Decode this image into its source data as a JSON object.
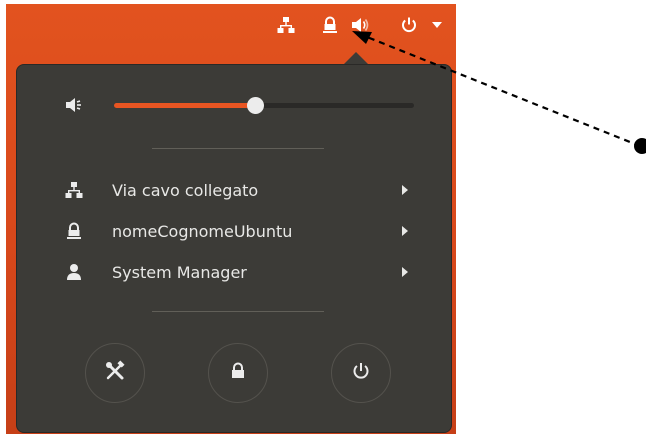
{
  "topbar": {
    "icons": [
      "network-wired-icon",
      "vpn-lock-icon",
      "volume-icon",
      "power-icon",
      "dropdown-arrow-icon"
    ]
  },
  "volume": {
    "level": 0.47,
    "icon": "volume-icon"
  },
  "menu_items": [
    {
      "icon": "network-wired-icon",
      "label": "Via cavo collegato"
    },
    {
      "icon": "vpn-lock-icon",
      "label": "nomeCognomeUbuntu"
    },
    {
      "icon": "user-icon",
      "label": "System Manager"
    }
  ],
  "action_buttons": [
    "settings-icon",
    "lock-icon",
    "power-icon"
  ],
  "colors": {
    "accent": "#e85522",
    "panel": "#3c3b37",
    "desktop": "#dd4f1d",
    "text": "#e8e8e6"
  }
}
